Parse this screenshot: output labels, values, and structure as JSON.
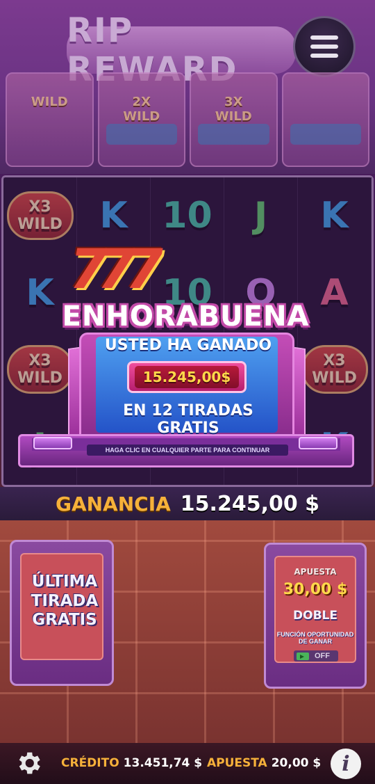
{
  "header": {
    "logo_text": "RIP REWARD",
    "menu_icon": "hamburger-icon",
    "tiers": [
      {
        "label": "WILD"
      },
      {
        "label": "2X\nWILD"
      },
      {
        "label": "3X\nWILD"
      },
      {
        "label": ""
      }
    ]
  },
  "reels": {
    "rows": [
      [
        "X3\nWILD",
        "K",
        "10",
        "J",
        "K"
      ],
      [
        "K",
        "",
        "10",
        "Q",
        "A"
      ],
      [
        "X3\nWILD",
        "",
        "",
        "",
        "X3\nWILD"
      ],
      [
        "J",
        "",
        "",
        "",
        "K"
      ]
    ]
  },
  "popup": {
    "sevens": "777",
    "title": "ENHORABUENA",
    "subtitle": "USTED HA GANADO",
    "amount": "15.245,00$",
    "spins_text": "EN 12 TIRADAS GRATIS",
    "continue_text": "HAGA CLIC EN CUALQUIER PARTE PARA CONTINUAR"
  },
  "win_bar": {
    "label": "GANANCIA",
    "value": "15.245,00 $"
  },
  "left_panel": {
    "text_line1": "ÚLTIMA",
    "text_line2": "TIRADA",
    "text_line3": "GRATIS"
  },
  "right_panel": {
    "title": "APUESTA",
    "value": "30,00 $",
    "double_label": "DOBLE",
    "feature_label": "FUNCIÓN OPORTUNIDAD DE GANAR",
    "toggle_state": "OFF"
  },
  "footer": {
    "credit_label": "CRÉDITO",
    "credit_value": "13.451,74 $",
    "bet_label": "APUESTA",
    "bet_value": "20,00 $",
    "info_glyph": "i"
  },
  "colors": {
    "accent_gold": "#f6b13a",
    "amount_yellow": "#ffd84a",
    "popup_pink": "#c44db7",
    "screen_blue": "#2453c8"
  }
}
